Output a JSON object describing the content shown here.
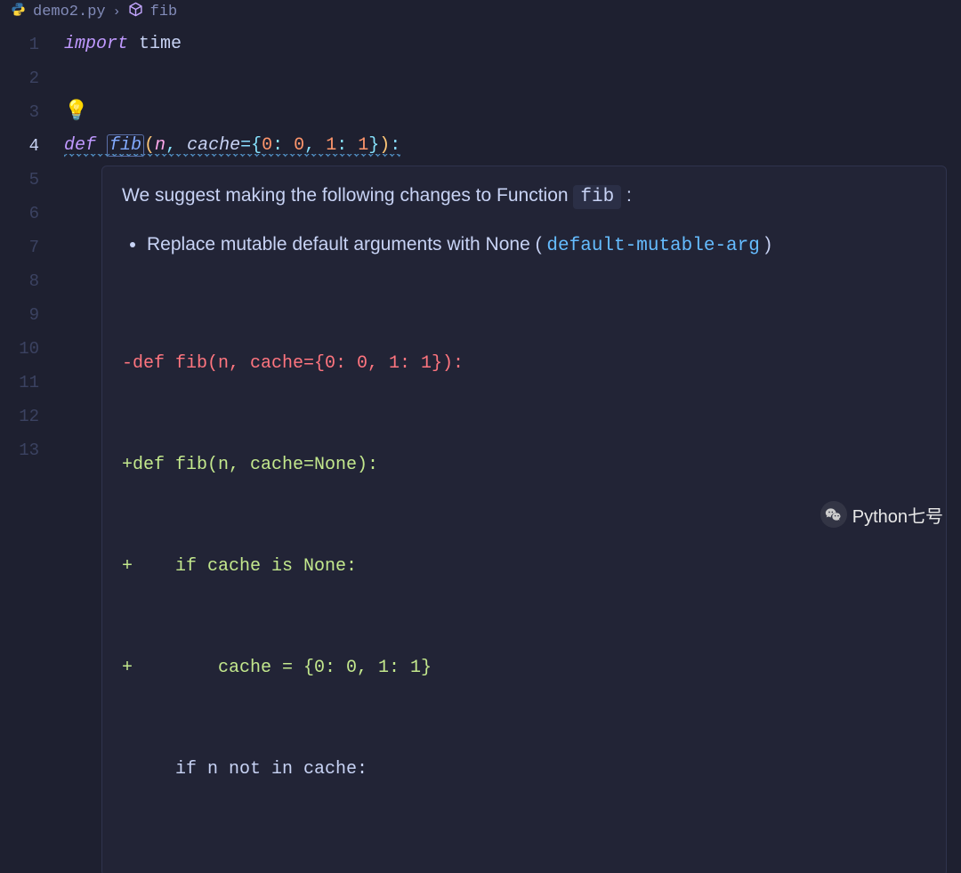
{
  "breadcrumb": {
    "file": "demo2.py",
    "symbol": "fib"
  },
  "lines": [
    "1",
    "2",
    "3",
    "4",
    "5",
    "6",
    "7",
    "8",
    "9",
    "10",
    "11",
    "12",
    "13"
  ],
  "activeLine": "4",
  "code": {
    "l1_kw": "import",
    "l1_mod": " time",
    "l4_def": "def ",
    "l4_fn": "fib",
    "l4_open": "(",
    "l4_p1": "n",
    "l4_c1": ", ",
    "l4_p2": "cache",
    "l4_eq": "=",
    "l4_b1": "{",
    "l4_k0": "0",
    "l4_col1": ": ",
    "l4_v0": "0",
    "l4_c2": ", ",
    "l4_k1": "1",
    "l4_col2": ": ",
    "l4_v1": "1",
    "l4_b2": "}",
    "l4_close": ")",
    "l4_colon": ":"
  },
  "hover": {
    "msg_pre": "We suggest making the following changes to Function ",
    "msg_fn": "fib",
    "msg_post": " :",
    "bullet_pre": "Replace mutable default arguments with None ( ",
    "bullet_link": "default-mutable-arg",
    "bullet_post": " )",
    "diff": {
      "d1": "-def fib(n, cache={0: 0, 1: 1}):",
      "d2": "+def fib(n, cache=None):",
      "d3": "+    if cache is None:",
      "d4": "+        cache = {0: 0, 1: 1}",
      "d5": "     if n not in cache:"
    }
  },
  "watermark": "Python七号"
}
